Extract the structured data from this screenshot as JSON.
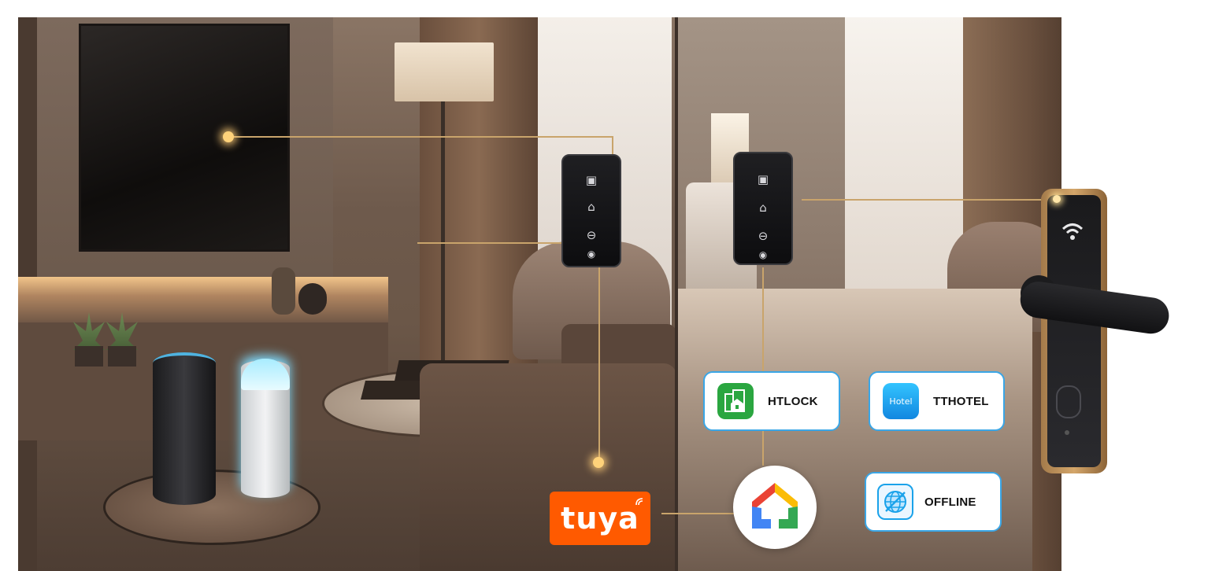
{
  "apps": {
    "htlock": {
      "label": "HTLOCK",
      "icon": "building-lock-icon",
      "color": "#2aa640"
    },
    "tthotel": {
      "label": "TTHOTEL",
      "icon_text": "Hotel",
      "color": "#1aa2ea"
    },
    "offline": {
      "label": "OFFLINE",
      "icon": "globe-offline-icon",
      "color": "#1aa2ea"
    },
    "tuya": {
      "label": "tuya",
      "color": "#ff5a00"
    },
    "google_home": {
      "icon": "google-home-icon",
      "colors": [
        "#ea4335",
        "#fbbc05",
        "#34a853",
        "#4285f4"
      ]
    }
  },
  "accent": {
    "line_color": "#c9a46b",
    "card_border": "#3aa6e6"
  }
}
